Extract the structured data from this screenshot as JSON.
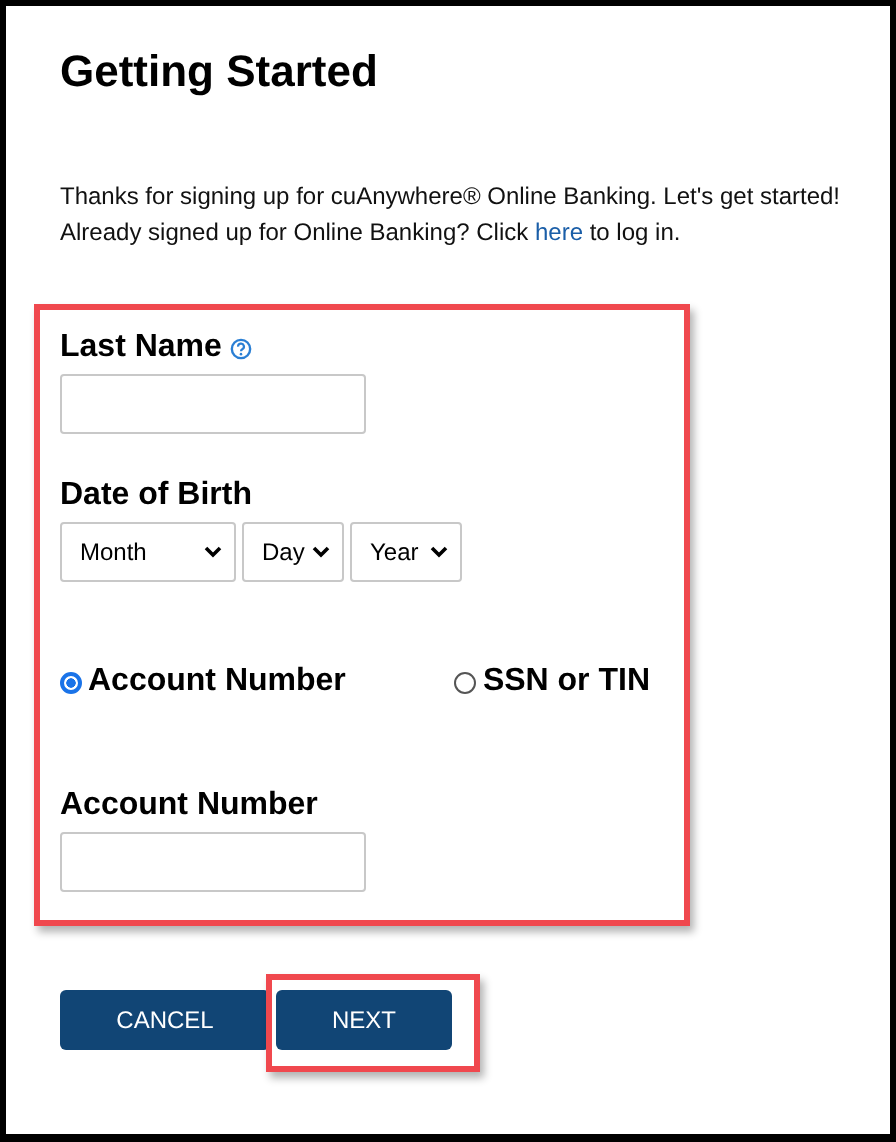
{
  "title": "Getting Started",
  "intro": {
    "line1": "Thanks for signing up for cuAnywhere® Online Banking. Let's get started!",
    "before": "Already signed up for Online Banking? Click",
    "link": "here",
    "after": "to log in."
  },
  "form": {
    "highlighted": true,
    "last_name": {
      "label": "Last Name"
    },
    "date_of_birth": {
      "label": "Date of Birth",
      "selects": [
        {
          "value": "Month",
          "kind": "wide"
        },
        {
          "value": "Day",
          "kind": "narrow"
        },
        {
          "value": "Year",
          "kind": "medium"
        }
      ]
    },
    "id_type": [
      {
        "label": "Account Number",
        "selected": true
      },
      {
        "label": "SSN or TIN",
        "selected": false
      }
    ],
    "account_number": {
      "label": "Account Number"
    }
  },
  "buttons": [
    {
      "label": "CANCEL",
      "highlighted": false
    },
    {
      "label": "NEXT",
      "highlighted": true
    }
  ]
}
